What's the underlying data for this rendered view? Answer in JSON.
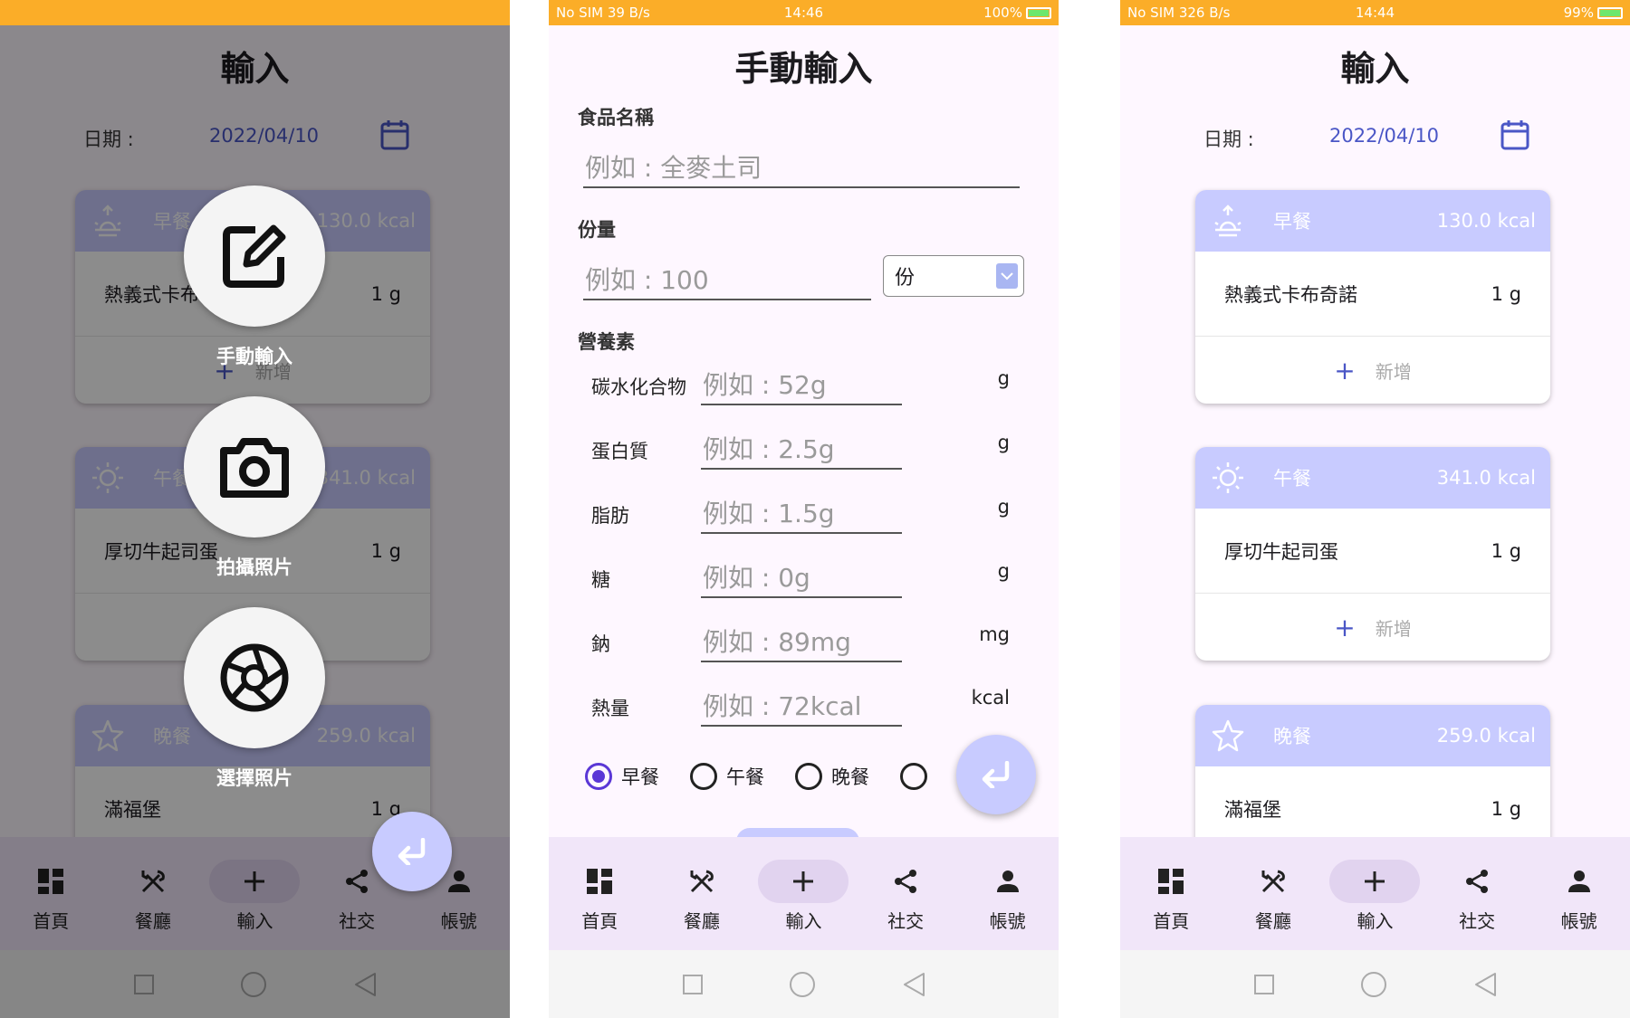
{
  "statusbar": {
    "phone1": {
      "left": "",
      "time": "",
      "right": ""
    },
    "phone2": {
      "left": "No SIM  39 B/s",
      "time": "14:46",
      "right": "100%"
    },
    "phone3": {
      "left": "No SIM  326 B/s",
      "time": "14:44",
      "right": "99%"
    }
  },
  "input_page": {
    "title": "輸入",
    "date_label": "日期 :",
    "date_value": "2022/04/10",
    "meals": [
      {
        "name": "早餐",
        "kcal": "130.0 kcal",
        "icon": "sunrise-icon",
        "food": "熱義式卡布奇諾",
        "qty": "1 g",
        "add_label": "新增"
      },
      {
        "name": "午餐",
        "kcal": "341.0 kcal",
        "icon": "sun-icon",
        "food": "厚切牛起司蛋",
        "qty": "1 g",
        "add_label": "新增"
      },
      {
        "name": "晚餐",
        "kcal": "259.0 kcal",
        "icon": "star-icon",
        "food": "滿福堡",
        "qty": "1 g",
        "add_label": ""
      }
    ]
  },
  "overlay": {
    "manual_label": "手動輸入",
    "camera_label": "拍攝照片",
    "gallery_label": "選擇照片",
    "phone1_visible_meals": {
      "breakfast_food": "熱義式卡布奇諾",
      "lunch_food": "厚切牛起司蛋"
    }
  },
  "manual_form": {
    "title": "手動輸入",
    "food_name_label": "食品名稱",
    "food_name_placeholder": "例如 : 全麥土司",
    "portion_label": "份量",
    "portion_placeholder": "例如 : 100",
    "portion_unit": "份",
    "nutrients_label": "營養素",
    "nutrients": [
      {
        "name": "碳水化合物",
        "placeholder": "例如 : 52g",
        "unit": "g"
      },
      {
        "name": "蛋白質",
        "placeholder": "例如 : 2.5g",
        "unit": "g"
      },
      {
        "name": "脂肪",
        "placeholder": "例如 : 1.5g",
        "unit": "g"
      },
      {
        "name": "糖",
        "placeholder": "例如 : 0g",
        "unit": "g"
      },
      {
        "name": "鈉",
        "placeholder": "例如 : 89mg",
        "unit": "mg"
      },
      {
        "name": "熱量",
        "placeholder": "例如 : 72kcal",
        "unit": "kcal"
      }
    ],
    "meal_options": [
      "早餐",
      "午餐",
      "晚餐"
    ],
    "selected_meal": "早餐"
  },
  "nav": {
    "items": [
      {
        "label": "首頁",
        "icon": "dashboard-icon"
      },
      {
        "label": "餐廳",
        "icon": "utensils-icon"
      },
      {
        "label": "輸入",
        "icon": "plus-icon"
      },
      {
        "label": "社交",
        "icon": "share-icon"
      },
      {
        "label": "帳號",
        "icon": "person-icon"
      }
    ],
    "active": "輸入"
  },
  "colors": {
    "statusbar": "#fbad28",
    "card_header": "#c8cbff",
    "accent": "#4a56c6",
    "nav_bg": "#f1e6f9",
    "radio": "#5a37d6"
  }
}
